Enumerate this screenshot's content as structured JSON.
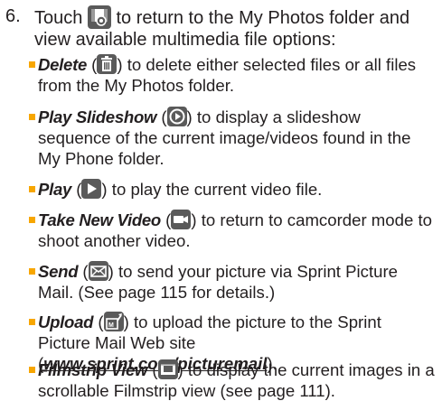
{
  "step": {
    "number": "6.",
    "text_before_icon": "Touch",
    "text_after_icon": "to return to the My Photos folder and view available multimedia file options:",
    "icon": "media-folder-icon"
  },
  "options": [
    {
      "term": "Delete",
      "icon": "trash-icon",
      "text": "to delete either selected files or all files from the My Photos folder."
    },
    {
      "term": "Play Slideshow",
      "icon": "slideshow-icon",
      "text": "to display a slideshow sequence of the current image/videos found in the My Phone folder."
    },
    {
      "term": "Play",
      "icon": "play-icon",
      "text": "to play the current video file."
    },
    {
      "term": "Take New Video",
      "icon": "camcorder-icon",
      "text": "to return to camcorder mode to shoot another video."
    },
    {
      "term": "Send",
      "icon": "envelope-icon",
      "text": "to send your picture via Sprint Picture Mail. (See page 115 for details.)"
    },
    {
      "term": "Upload",
      "icon": "upload-icon",
      "text": "to upload the picture to the Sprint Picture Mail Web site (",
      "link": "www.sprint.com/picturemail",
      "text_after_link": ")."
    },
    {
      "term": "Filmstrip View",
      "icon": "filmstrip-icon",
      "text": "to display the current images in a scrollable Filmstrip view (see page 111)."
    }
  ],
  "colors": {
    "text": "#231f20",
    "bullet": "#f7a600",
    "icon_bg": "#5a5a5a"
  }
}
